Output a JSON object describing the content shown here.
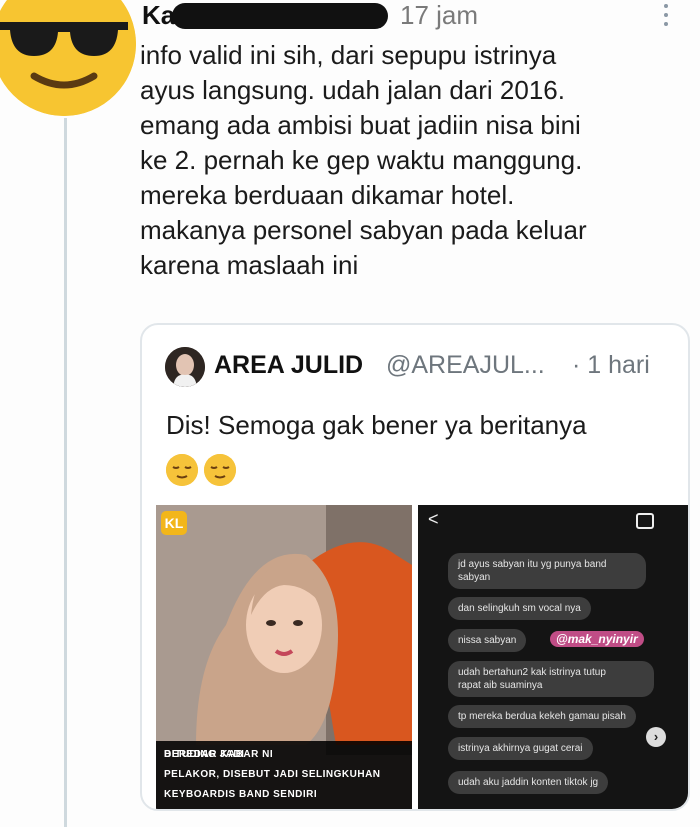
{
  "tweet": {
    "author_name": "Ka",
    "timestamp": "17 jam",
    "text_lines": [
      "info valid ini sih, dari sepupu istrinya",
      "ayus langsung. udah jalan dari 2016.",
      "emang ada ambisi buat jadiin nisa bini",
      "ke 2. pernah ke gep waktu manggung.",
      "mereka berduaan dikamar hotel.",
      "makanya personel sabyan pada keluar",
      "karena maslaah ini"
    ],
    "avatar_icon": "sunglasses-emoji-icon",
    "menu_icon": "more-vertical-icon"
  },
  "quote": {
    "name": "AREA JULID",
    "handle": "@AREAJUL...",
    "time": "· 1 hari",
    "text": "Dis! Semoga gak bener ya beritanya",
    "emoji_icon": "relieved-face-emoji-icon",
    "media_left": {
      "logo": "KL",
      "caption_line1_left": "BEREDAR KABAR NI",
      "caption_line1_right": "DITUDING JADI",
      "caption_line2": "PELAKOR, DISEBUT JADI SELINGKUHAN",
      "caption_line3": "KEYBOARDIS BAND SENDIRI"
    },
    "media_right": {
      "back_glyph": "<",
      "messages": [
        "jd ayus sabyan itu yg punya band",
        "sabyan",
        "dan selingkuh sm vocal nya",
        "nissa sabyan",
        "udah bertahun2 kak istrinya tutup",
        "rapat aib suaminya",
        "tp mereka berdua kekeh gamau pisah",
        "istrinya akhirnya gugat cerai",
        "udah aku jaddin konten tiktok jg"
      ],
      "watermark": "@mak_nyinyir",
      "scroll_glyph": "›"
    }
  },
  "colors": {
    "thread_line": "#cfd9de",
    "avatar_yellow": "#f7c531",
    "muted_text": "#6e767d",
    "watermark_bg": "#c04d86"
  }
}
